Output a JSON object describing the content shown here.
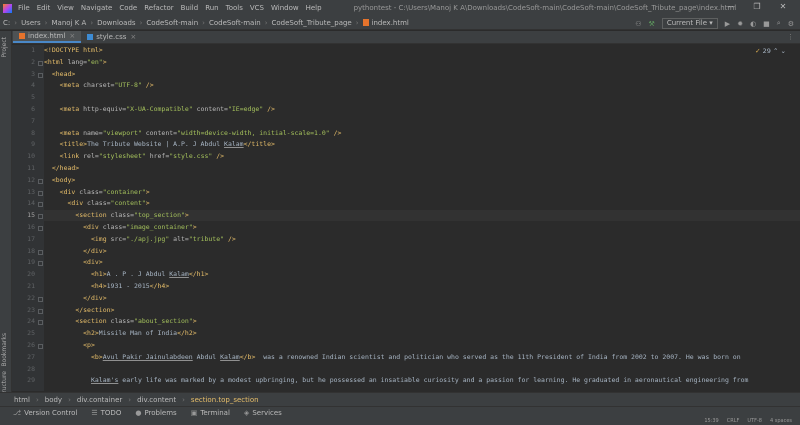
{
  "menubar": {
    "items": [
      "File",
      "Edit",
      "View",
      "Navigate",
      "Code",
      "Refactor",
      "Build",
      "Run",
      "Tools",
      "VCS",
      "Window",
      "Help"
    ],
    "window_title": "pythontest - C:\\Users\\Manoj K A\\Downloads\\CodeSoft-main\\CodeSoft-main\\CodeSoft_Tribute_page\\index.html"
  },
  "navbar": {
    "crumbs": [
      "C:",
      "Users",
      "Manoj K A",
      "Downloads",
      "CodeSoft-main",
      "CodeSoft-main",
      "CodeSoft_Tribute_page",
      "index.html"
    ],
    "run_config": "Current File"
  },
  "tabs": [
    {
      "label": "index.html",
      "active": true,
      "color": "#e5732c"
    },
    {
      "label": "style.css",
      "active": false,
      "color": "#3d8bd3"
    }
  ],
  "side_labels": {
    "project": "Project",
    "bookmarks": "Bookmarks",
    "structure": "Structure"
  },
  "inspection": {
    "count": "29"
  },
  "line_numbers": [
    "1",
    "2",
    "3",
    "4",
    "5",
    "6",
    "7",
    "8",
    "9",
    "10",
    "11",
    "12",
    "13",
    "14",
    "15",
    "16",
    "17",
    "18",
    "19",
    "20",
    "21",
    "22",
    "23",
    "24",
    "25",
    "26",
    "27",
    "28",
    "29"
  ],
  "current_line": 15,
  "code_lines": [
    [
      [
        "tg",
        "<!DOCTYPE html>"
      ]
    ],
    [
      [
        "tg",
        "<html"
      ],
      [
        "at",
        " lang="
      ],
      [
        "vl",
        "\"en\""
      ],
      [
        "tg",
        ">"
      ]
    ],
    [
      [
        "ws",
        "  "
      ],
      [
        "tg",
        "<head>"
      ]
    ],
    [
      [
        "ws",
        "    "
      ],
      [
        "tg",
        "<meta"
      ],
      [
        "at",
        " charset="
      ],
      [
        "vl",
        "\"UTF-8\""
      ],
      [
        "ws",
        " "
      ],
      [
        "tg",
        "/>"
      ]
    ],
    [],
    [
      [
        "ws",
        "    "
      ],
      [
        "tg",
        "<meta"
      ],
      [
        "at",
        " http-equiv="
      ],
      [
        "vl",
        "\"X-UA-Compatible\""
      ],
      [
        "at",
        " content="
      ],
      [
        "vl",
        "\"IE=edge\""
      ],
      [
        "ws",
        " "
      ],
      [
        "tg",
        "/>"
      ]
    ],
    [],
    [
      [
        "ws",
        "    "
      ],
      [
        "tg",
        "<meta"
      ],
      [
        "at",
        " name="
      ],
      [
        "vl",
        "\"viewport\""
      ],
      [
        "at",
        " content="
      ],
      [
        "vl",
        "\"width=device-width, initial-scale=1.0\""
      ],
      [
        "ws",
        " "
      ],
      [
        "tg",
        "/>"
      ]
    ],
    [
      [
        "ws",
        "    "
      ],
      [
        "tg",
        "<title>"
      ],
      [
        "tx",
        "The Tribute Website | A.P. J Abdul "
      ],
      [
        "txu",
        "Kalam"
      ],
      [
        "tg",
        "</title>"
      ]
    ],
    [
      [
        "ws",
        "    "
      ],
      [
        "tg",
        "<link"
      ],
      [
        "at",
        " rel="
      ],
      [
        "vl",
        "\"stylesheet\""
      ],
      [
        "at",
        " href="
      ],
      [
        "vl",
        "\"style.css\""
      ],
      [
        "ws",
        " "
      ],
      [
        "tg",
        "/>"
      ]
    ],
    [
      [
        "ws",
        "  "
      ],
      [
        "tg",
        "</head>"
      ]
    ],
    [
      [
        "ws",
        "  "
      ],
      [
        "tg",
        "<body>"
      ]
    ],
    [
      [
        "ws",
        "    "
      ],
      [
        "tg",
        "<div"
      ],
      [
        "at",
        " class="
      ],
      [
        "vl",
        "\"container\""
      ],
      [
        "tg",
        ">"
      ]
    ],
    [
      [
        "ws",
        "      "
      ],
      [
        "tg",
        "<div"
      ],
      [
        "at",
        " class="
      ],
      [
        "vl",
        "\"content\""
      ],
      [
        "tg",
        ">"
      ]
    ],
    [
      [
        "ws",
        "        "
      ],
      [
        "tg",
        "<section"
      ],
      [
        "at",
        " class="
      ],
      [
        "vl",
        "\"top_section\""
      ],
      [
        "tg",
        ">"
      ]
    ],
    [
      [
        "ws",
        "          "
      ],
      [
        "tg",
        "<div"
      ],
      [
        "at",
        " class="
      ],
      [
        "vl",
        "\"image_container\""
      ],
      [
        "tg",
        ">"
      ]
    ],
    [
      [
        "ws",
        "            "
      ],
      [
        "tg",
        "<img"
      ],
      [
        "at",
        " src="
      ],
      [
        "vl",
        "\"./apj.jpg\""
      ],
      [
        "at",
        " alt="
      ],
      [
        "vl",
        "\"tribute\""
      ],
      [
        "ws",
        " "
      ],
      [
        "tg",
        "/>"
      ]
    ],
    [
      [
        "ws",
        "          "
      ],
      [
        "tg",
        "</div>"
      ]
    ],
    [
      [
        "ws",
        "          "
      ],
      [
        "tg",
        "<div>"
      ]
    ],
    [
      [
        "ws",
        "            "
      ],
      [
        "tg",
        "<h1>"
      ],
      [
        "tx",
        "A . P . J Abdul "
      ],
      [
        "txu",
        "Kalam"
      ],
      [
        "tg",
        "</h1>"
      ]
    ],
    [
      [
        "ws",
        "            "
      ],
      [
        "tg",
        "<h4>"
      ],
      [
        "tx",
        "1931 - 2015"
      ],
      [
        "tg",
        "</h4>"
      ]
    ],
    [
      [
        "ws",
        "          "
      ],
      [
        "tg",
        "</div>"
      ]
    ],
    [
      [
        "ws",
        "        "
      ],
      [
        "tg",
        "</section>"
      ]
    ],
    [
      [
        "ws",
        "        "
      ],
      [
        "tg",
        "<section"
      ],
      [
        "at",
        " class="
      ],
      [
        "vl",
        "\"about_section\""
      ],
      [
        "tg",
        ">"
      ]
    ],
    [
      [
        "ws",
        "          "
      ],
      [
        "tg",
        "<h2>"
      ],
      [
        "tx",
        "Missile Man of India"
      ],
      [
        "tg",
        "</h2>"
      ]
    ],
    [
      [
        "ws",
        "          "
      ],
      [
        "tg",
        "<p>"
      ]
    ],
    [
      [
        "ws",
        "            "
      ],
      [
        "tg",
        "<b>"
      ],
      [
        "txu",
        "Avul Pakir Jainulabdeen"
      ],
      [
        "tx",
        " Abdul "
      ],
      [
        "txu",
        "Kalam"
      ],
      [
        "tg",
        "</b>"
      ],
      [
        "tx",
        "  was a renowned Indian scientist and politician who served as the 11th President of India from 2002 to 2007. He was born on"
      ]
    ],
    [],
    [
      [
        "ws",
        "            "
      ],
      [
        "txu",
        "Kalam's"
      ],
      [
        "tx",
        " early life was marked by a modest upbringing, but he possessed an insatiable curiosity and a passion for learning. He graduated in aeronautical engineering from"
      ]
    ]
  ],
  "breadcrumb": [
    "html",
    "body",
    "div.container",
    "div.content",
    "section.top_section"
  ],
  "toolwindows": [
    {
      "icon": "⎇",
      "label": "Version Control"
    },
    {
      "icon": "☰",
      "label": "TODO"
    },
    {
      "icon": "●",
      "label": "Problems"
    },
    {
      "icon": "▣",
      "label": "Terminal"
    },
    {
      "icon": "◈",
      "label": "Services"
    }
  ],
  "status": [
    "15:39",
    "CRLF",
    "UTF-8",
    "4 spaces"
  ]
}
